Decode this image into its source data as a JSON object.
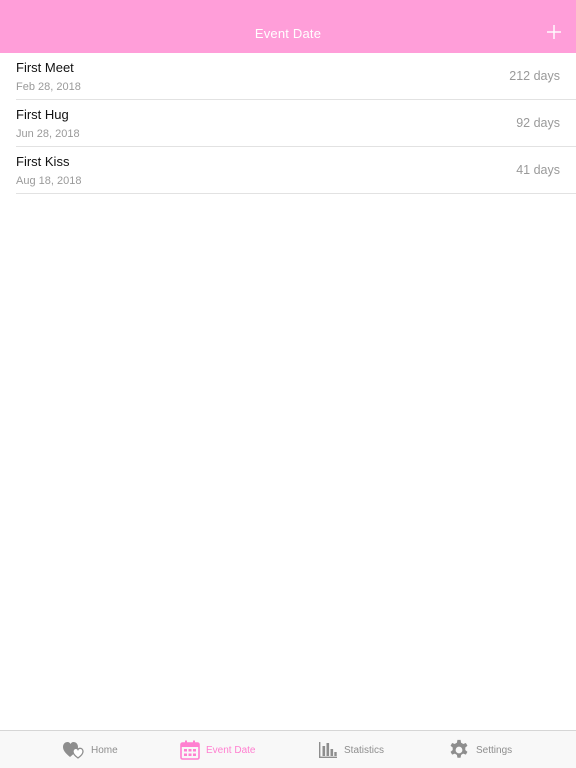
{
  "header": {
    "title": "Event Date",
    "background": "#ff9ed9"
  },
  "events": [
    {
      "title": "First Meet",
      "date": "Feb 28, 2018",
      "days": "212 days"
    },
    {
      "title": "First Hug",
      "date": "Jun 28, 2018",
      "days": "92 days"
    },
    {
      "title": "First Kiss",
      "date": "Aug 18, 2018",
      "days": "41 days"
    }
  ],
  "tabbar": {
    "tabs": [
      {
        "label": "Home",
        "icon": "hearts-icon"
      },
      {
        "label": "Event Date",
        "icon": "calendar-icon",
        "active": true
      },
      {
        "label": "Statistics",
        "icon": "bar-chart-icon"
      },
      {
        "label": "Settings",
        "icon": "gear-icon"
      }
    ],
    "active_color": "#ff7fd0",
    "inactive_color": "#8e8e8e"
  }
}
